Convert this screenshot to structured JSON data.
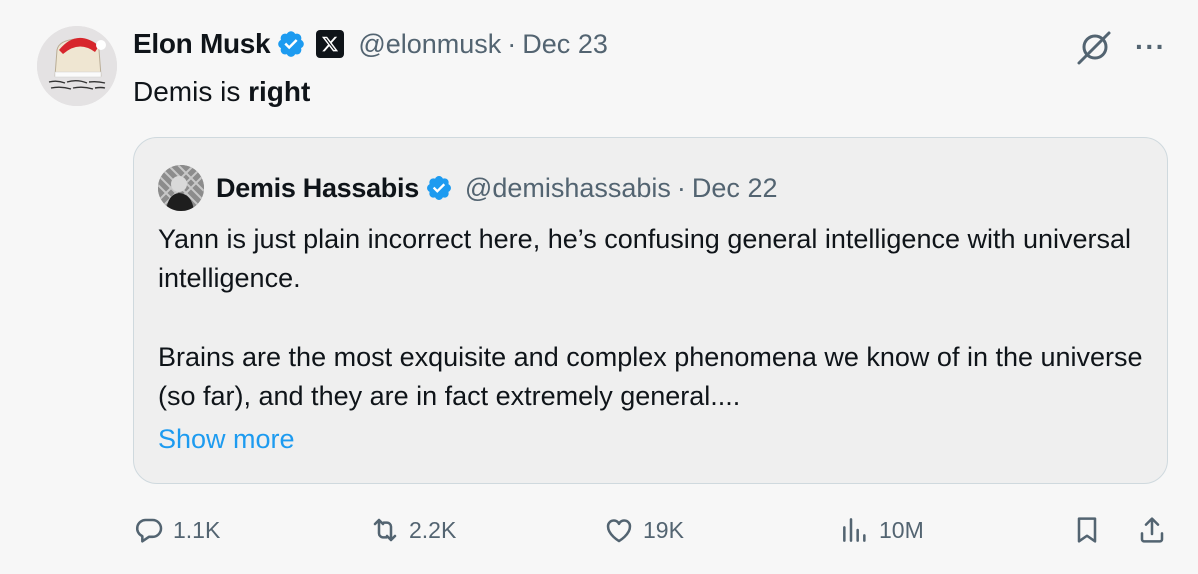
{
  "tweet": {
    "author_name": "Elon Musk",
    "handle": "@elonmusk",
    "separator": "·",
    "date": "Dec 23",
    "text_plain": "Demis is ",
    "text_bold": "right",
    "more_label": "···"
  },
  "quote": {
    "author_name": "Demis Hassabis",
    "handle": "@demishassabis",
    "separator": "·",
    "date": "Dec 22",
    "paragraph_1": "Yann is just plain incorrect here, he’s confusing general intelligence with universal intelligence.",
    "paragraph_2": "Brains are the most exquisite and complex phenomena we know of in the universe (so far), and they are in fact extremely general....",
    "show_more": "Show more"
  },
  "actions": {
    "replies": "1.1K",
    "reposts": "2.2K",
    "likes": "19K",
    "views": "10M"
  },
  "colors": {
    "verified": "#1d9bf0",
    "link": "#1d9bf0",
    "secondary_text": "#536471",
    "background": "#f7f7f7"
  },
  "icons": [
    "verified-badge-icon",
    "x-affiliation-icon",
    "grok-icon",
    "more-icon",
    "reply-icon",
    "repost-icon",
    "like-icon",
    "views-icon",
    "bookmark-icon",
    "share-icon"
  ]
}
